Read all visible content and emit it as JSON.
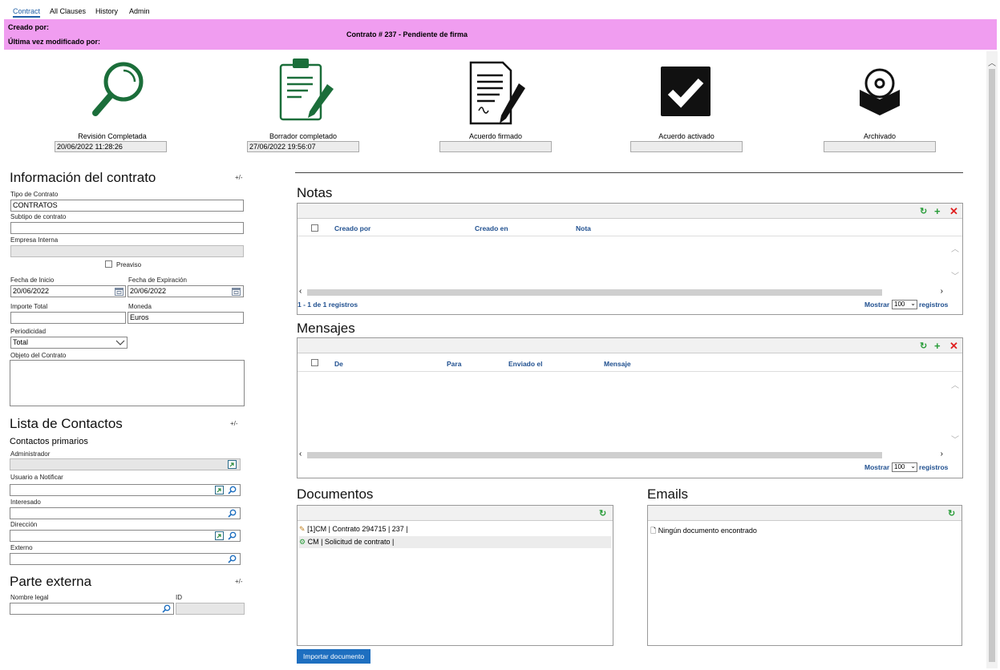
{
  "tabs": [
    "Contract",
    "All Clauses",
    "History",
    "Admin"
  ],
  "header": {
    "created_by": "Creado por:",
    "modified_by": "Última vez modificado por:",
    "title": "Contrato # 237 - Pendiente de firma"
  },
  "stages": [
    {
      "label": "Revisión Completada",
      "value": "20/06/2022 11:28:26",
      "icon": "magnifier-icon"
    },
    {
      "label": "Borrador completado",
      "value": "27/06/2022 19:56:07",
      "icon": "clipboard-pencil-icon"
    },
    {
      "label": "Acuerdo firmado",
      "value": "",
      "icon": "signed-document-icon"
    },
    {
      "label": "Acuerdo activado",
      "value": "",
      "icon": "checkmark-icon"
    },
    {
      "label": "Archivado",
      "value": "",
      "icon": "archive-disc-icon"
    }
  ],
  "contract_info": {
    "title": "Información del contrato",
    "toggle": "+/-",
    "tipo_label": "Tipo de Contrato",
    "tipo_value": "CONTRATOS",
    "subtipo_label": "Subtipo de contrato",
    "subtipo_value": "",
    "empresa_label": "Empresa Interna",
    "empresa_value": "",
    "preaviso_label": "Preaviso",
    "inicio_label": "Fecha de Inicio",
    "inicio_value": "20/06/2022",
    "expiracion_label": "Fecha de Expiración",
    "expiracion_value": "20/06/2022",
    "importe_label": "Importe Total",
    "importe_value": "",
    "moneda_label": "Moneda",
    "moneda_value": "Euros",
    "periodicidad_label": "Periodicidad",
    "periodicidad_value": "Total",
    "objeto_label": "Objeto del Contrato",
    "objeto_value": ""
  },
  "contacts": {
    "title": "Lista de Contactos",
    "toggle": "+/-",
    "primary_title": "Contactos primarios",
    "admin_label": "Administrador",
    "notify_label": "Usuario a Notificar",
    "interested_label": "Interesado",
    "direction_label": "Dirección",
    "external_label": "Externo"
  },
  "external_party": {
    "title": "Parte externa",
    "toggle": "+/-",
    "name_label": "Nombre legal",
    "id_label": "ID"
  },
  "notas": {
    "title": "Notas",
    "columns": [
      "Creado por",
      "Creado en",
      "Nota"
    ],
    "records": "1 - 1 de 1 registros",
    "show": "Mostrar",
    "page_size": "100",
    "records_word": "registros"
  },
  "mensajes": {
    "title": "Mensajes",
    "columns": [
      "De",
      "Para",
      "Enviado el",
      "Mensaje"
    ],
    "show": "Mostrar",
    "page_size": "100",
    "records_word": "registros"
  },
  "documentos": {
    "title": "Documentos",
    "items": [
      "[1]CM | Contrato 294715 | 237 |",
      "CM | Solicitud de contrato |"
    ],
    "import_button": "Importar documento"
  },
  "emails": {
    "title": "Emails",
    "empty": "Ningún documento encontrado"
  },
  "colors": {
    "header_bg": "#f09df0",
    "accent": "#1f5fa6",
    "icon_green": "#1b6e3a",
    "add_green": "#2a9d3a",
    "delete_red": "#e02020",
    "button_blue": "#1e6fc0"
  }
}
